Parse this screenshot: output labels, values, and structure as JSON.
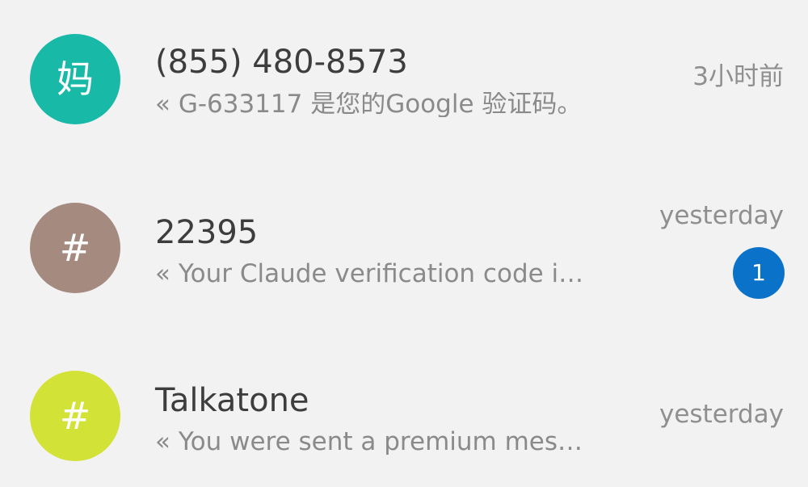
{
  "conversations": [
    {
      "avatar_text": "妈",
      "avatar_color": "#19b9a8",
      "name": "(855) 480-8573",
      "preview": "« G-633117 是您的Google 验证码。",
      "time": "3小时前",
      "unread": null
    },
    {
      "avatar_text": "#",
      "avatar_color": "#a58a80",
      "name": "22395",
      "preview": "« Your Claude verification code i…",
      "time": "yesterday",
      "unread": "1",
      "badge_color": "#0a72c9"
    },
    {
      "avatar_text": "#",
      "avatar_color": "#d3e236",
      "name": "Talkatone",
      "preview": "« You were sent a premium mes…",
      "time": "yesterday",
      "unread": null
    }
  ]
}
